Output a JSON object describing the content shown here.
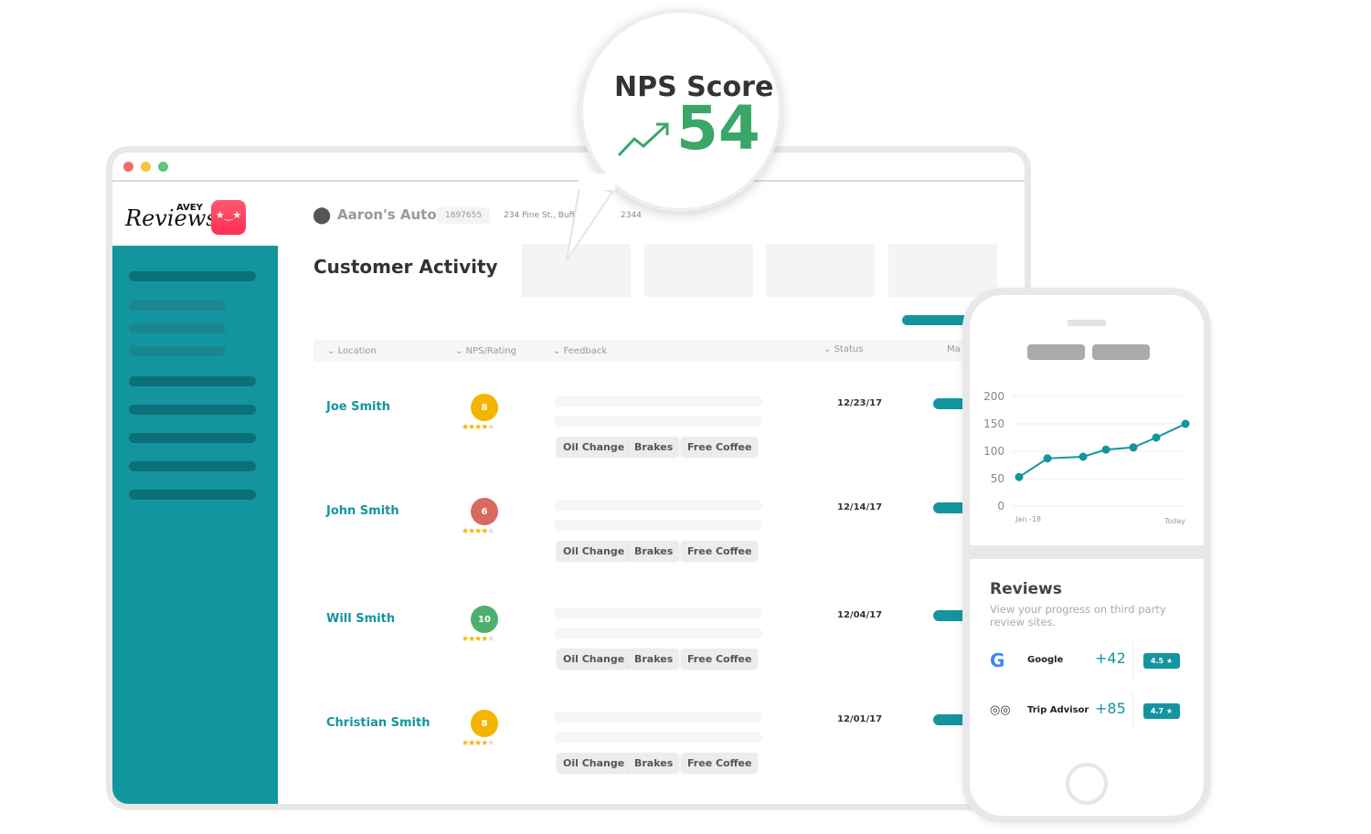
{
  "app": {
    "logo_text": "AVEY Reviews"
  },
  "header": {
    "location_name": "Aaron's Auto",
    "location_id": "1897655",
    "address": "234 Pine St., Buffal",
    "address_tail": "2344"
  },
  "page_title": "Customer Activity",
  "table": {
    "columns": [
      "Location",
      "NPS/Rating",
      "Feedback",
      "Status",
      "Ma"
    ],
    "rows": [
      {
        "name": "Joe Smith",
        "nps": "8",
        "nps_color": "#f5b400",
        "stars": 4,
        "tags": [
          "Oil Change",
          "Brakes",
          "Free Coffee"
        ],
        "date": "12/23/17"
      },
      {
        "name": "John Smith",
        "nps": "6",
        "nps_color": "#d9685f",
        "stars": 4,
        "tags": [
          "Oil Change",
          "Brakes",
          "Free Coffee"
        ],
        "date": "12/14/17"
      },
      {
        "name": "Will Smith",
        "nps": "10",
        "nps_color": "#4caf6e",
        "stars": 4,
        "tags": [
          "Oil Change",
          "Brakes",
          "Free Coffee"
        ],
        "date": "12/04/17"
      },
      {
        "name": "Christian Smith",
        "nps": "8",
        "nps_color": "#f5b400",
        "stars": 4,
        "tags": [
          "Oil Change",
          "Brakes",
          "Free Coffee"
        ],
        "date": "12/01/17"
      }
    ]
  },
  "nps": {
    "label": "NPS Score",
    "value": "54",
    "color": "#3aa66a"
  },
  "chart_data": {
    "type": "line",
    "x_labels": [
      "Jan -18",
      "Today"
    ],
    "values": [
      53,
      87,
      90,
      103,
      107,
      125,
      150
    ],
    "ylim": [
      0,
      200
    ],
    "yticks": [
      "200",
      "150",
      "100",
      "50",
      "0"
    ],
    "grid": true,
    "color": "#13959f"
  },
  "reviews": {
    "title": "Reviews",
    "subtitle": "View your progress on third party review sites.",
    "sites": [
      {
        "name": "Google",
        "change": "+42",
        "rating": "4.5 ★",
        "icon": "google-icon"
      },
      {
        "name": "Trip Advisor",
        "change": "+85",
        "rating": "4.7 ★",
        "icon": "tripadvisor-icon"
      }
    ]
  },
  "colors": {
    "accent": "#13959f"
  }
}
